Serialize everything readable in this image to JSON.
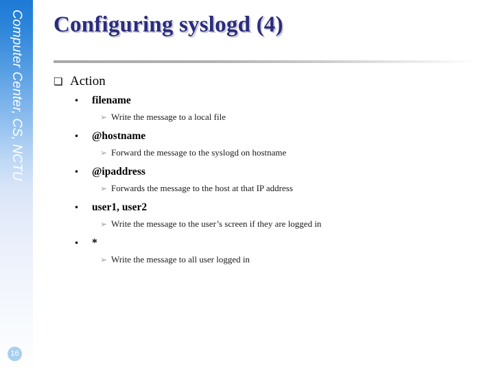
{
  "slide": {
    "title": "Configuring syslogd (4)",
    "page_number": "16",
    "sidebar_label": "Computer Center, CS, NCTU",
    "colors": {
      "title_text": "#2b2b7e",
      "title_shadow": "#c9c9d4",
      "sidebar_top": "#1d7ad6",
      "sidebar_bottom": "#ffffff",
      "page_badge": "#a8cff0",
      "divider": "#a9a9a9",
      "sub_bullet": "#9a9a9a",
      "background": "#ffffff"
    }
  },
  "markers": {
    "level1": "❏",
    "level2": "•",
    "level3": "➢"
  },
  "content": {
    "heading": "Action",
    "items": [
      {
        "term": "filename",
        "detail": "Write the message to a local file"
      },
      {
        "term": "@hostname",
        "detail": "Forward the message to the syslogd on hostname"
      },
      {
        "term": "@ipaddress",
        "detail": "Forwards the message to the host at that IP address"
      },
      {
        "term": "user1, user2",
        "detail": "Write the message to the user’s screen if they are logged in"
      },
      {
        "term": "*",
        "detail": "Write the message to all user logged in"
      }
    ]
  }
}
